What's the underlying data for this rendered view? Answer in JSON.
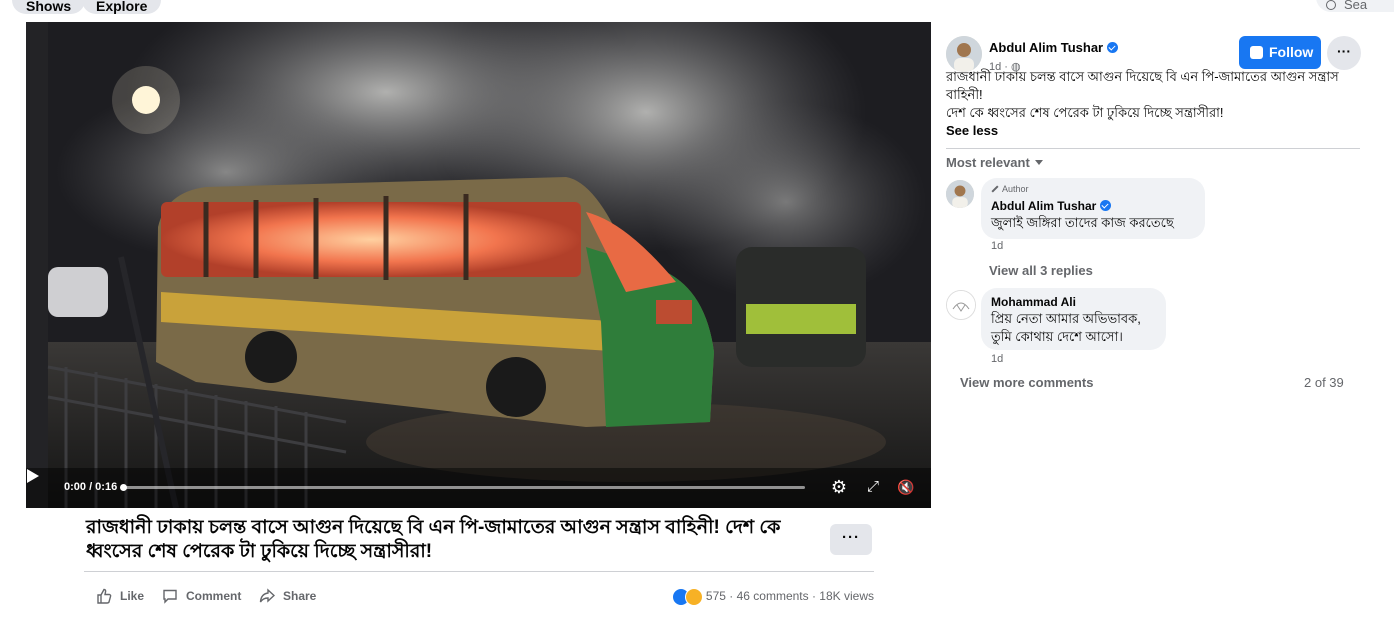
{
  "nav": {
    "tabs": [
      "Shows",
      "Explore"
    ],
    "search_placeholder": "Sea"
  },
  "video": {
    "time": "0:00 / 0:16",
    "progress": 0.0
  },
  "post": {
    "headline": "রাজধানী ঢাকায় চলন্ত বাসে আগুন দিয়েছে বি এন পি-জামাতের আগুন সন্ত্রাস বাহিনী! দেশ কে ধ্বংসের শেষ পেরেক টা ঢুকিয়ে দিচ্ছে সন্ত্রাসীরা!",
    "more_label": "···",
    "actions": {
      "like": "Like",
      "comment": "Comment",
      "share": "Share"
    },
    "reactions_count": "575",
    "comments_count": "46 comments",
    "views": "18K views"
  },
  "panel": {
    "author": "Abdul Alim Tushar",
    "meta": "1d · ",
    "follow_label": "Follow",
    "dots_label": "···",
    "text_line1": "রাজধানী ঢাকায় চলন্ত বাসে আগুন দিয়েছে বি এন পি-জামাতের আগুন সন্ত্রাস বাহিনী!",
    "text_line2": "দেশ কে ধ্বংসের শেষ পেরেক টা ঢুকিয়ে দিচ্ছে সন্ত্রাসীরা!",
    "see_less": "See less",
    "sort_label": "Most relevant",
    "comments": [
      {
        "badge": "Author",
        "name": "Abdul Alim Tushar",
        "text": "জুলাই জঙ্গিরা তাদের কাজ করতেছে",
        "time": "1d"
      },
      {
        "name": "Mohammad Ali",
        "text1": "প্রিয় নেতা আমার অভিভাবক,",
        "text2": "তুমি কোথায় দেশে আসো।",
        "time": "1d"
      }
    ],
    "view_replies": "View all 3 replies",
    "view_more": "View more comments",
    "count": "2 of 39"
  },
  "colors": {
    "accent": "#1877f2",
    "secondary_text": "#65676b",
    "bubble": "#f0f2f5"
  }
}
